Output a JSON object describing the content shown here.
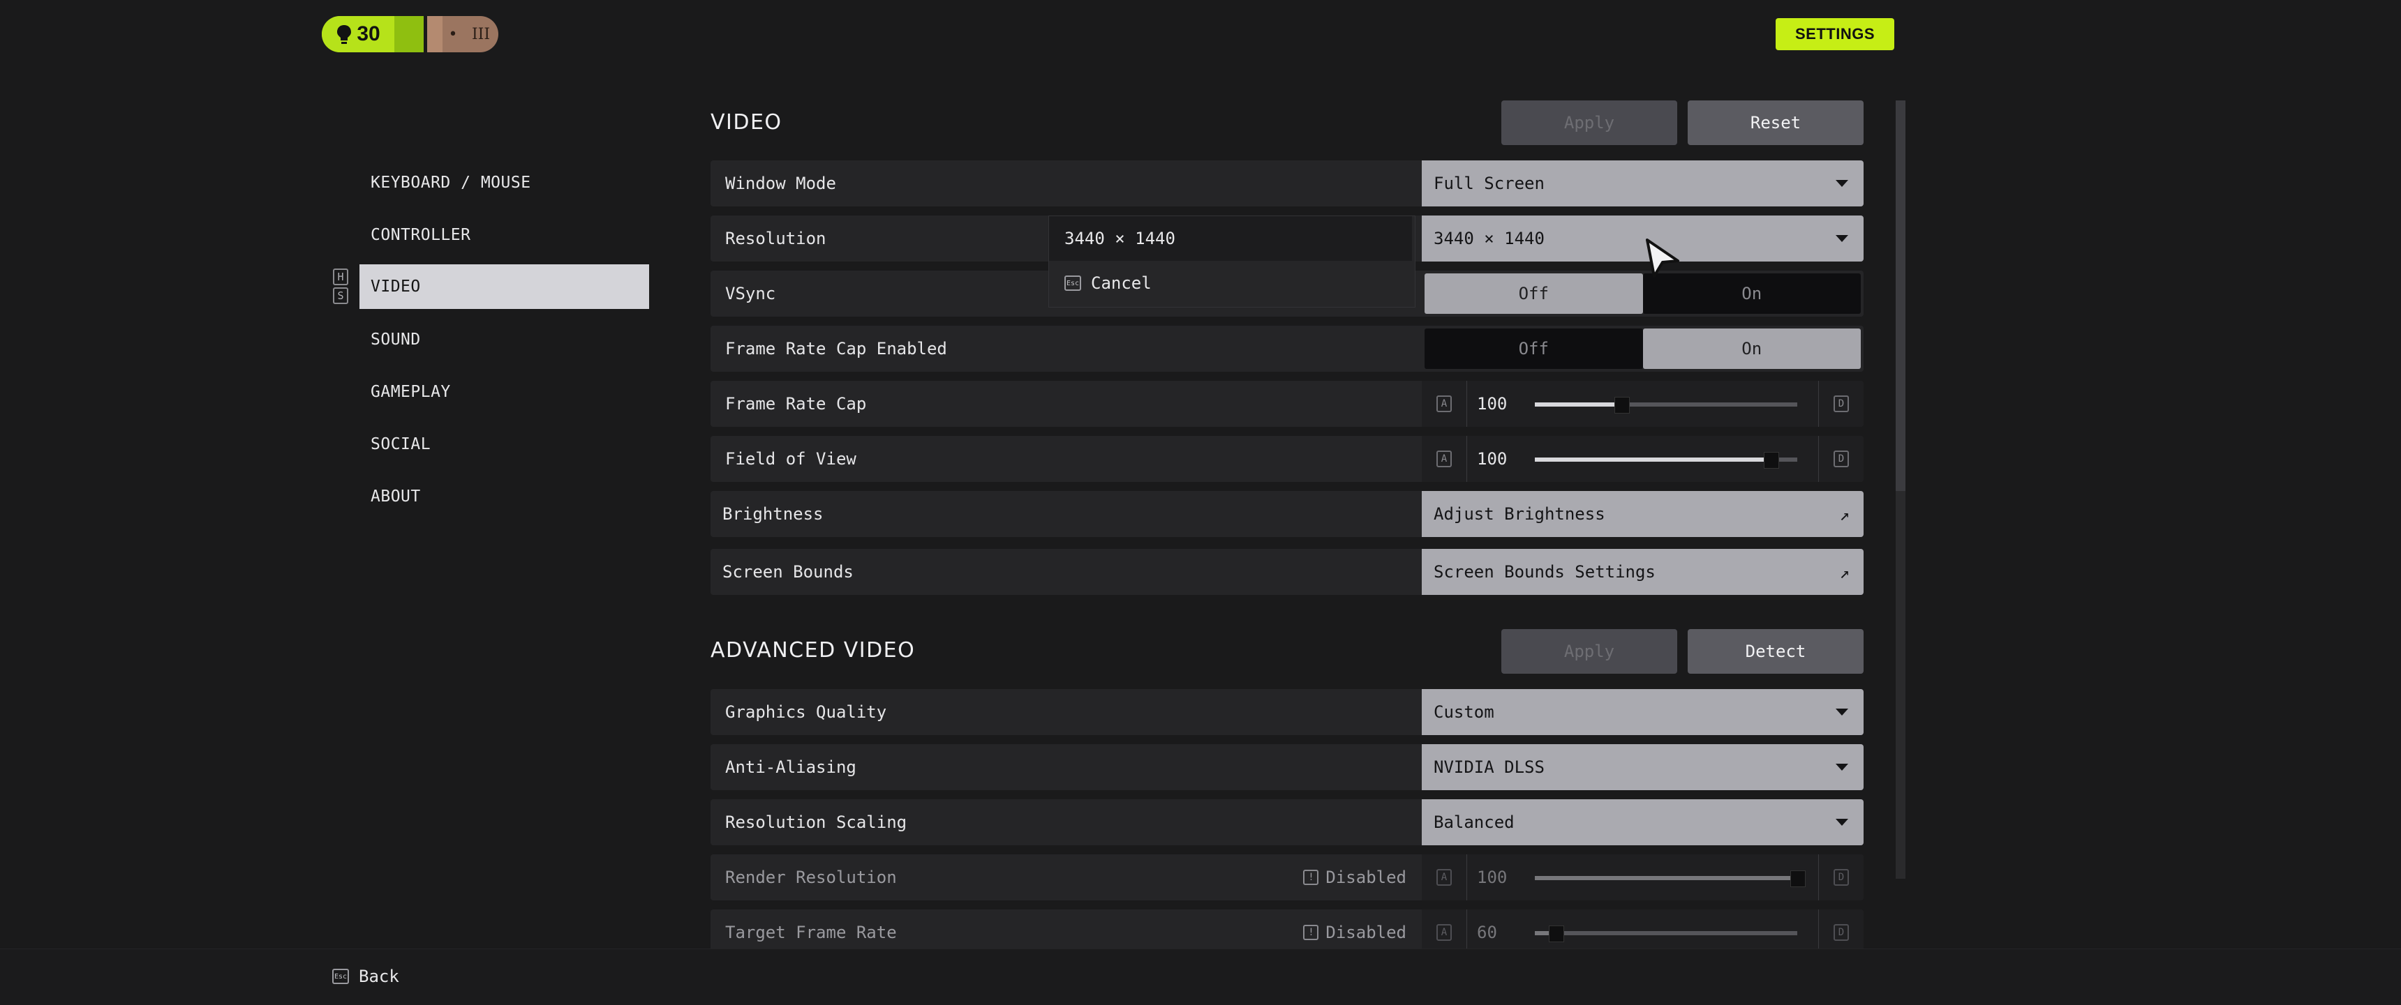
{
  "header": {
    "level": "30",
    "rank_marks": [
      "•",
      "III"
    ],
    "settings_label": "SETTINGS"
  },
  "sidebar": {
    "items": [
      {
        "label": "KEYBOARD / MOUSE"
      },
      {
        "label": "CONTROLLER"
      },
      {
        "label": "VIDEO"
      },
      {
        "label": "SOUND"
      },
      {
        "label": "GAMEPLAY"
      },
      {
        "label": "SOCIAL"
      },
      {
        "label": "ABOUT"
      }
    ],
    "hotkeys": [
      "H",
      "S"
    ]
  },
  "video": {
    "title": "VIDEO",
    "apply_label": "Apply",
    "reset_label": "Reset",
    "window_mode": {
      "label": "Window Mode",
      "value": "Full Screen"
    },
    "resolution": {
      "label": "Resolution",
      "value": "3440 × 1440"
    },
    "vsync": {
      "label": "VSync",
      "off": "Off",
      "on": "On",
      "selected": "Off"
    },
    "frame_cap_enabled": {
      "label": "Frame Rate Cap Enabled",
      "off": "Off",
      "on": "On",
      "selected": "On"
    },
    "frame_cap": {
      "label": "Frame Rate Cap",
      "value": "100",
      "key_left": "A",
      "key_right": "D",
      "level": 0.33
    },
    "fov": {
      "label": "Field of View",
      "value": "100",
      "key_left": "A",
      "key_right": "D",
      "level": 0.9
    },
    "brightness": {
      "label": "Brightness",
      "button": "Adjust Brightness"
    },
    "screen_bounds": {
      "label": "Screen Bounds",
      "button": "Screen Bounds Settings"
    }
  },
  "resolution_popup": {
    "option": "3440 × 1440",
    "cancel": "Cancel",
    "esc_key": "Esc"
  },
  "advanced": {
    "title": "ADVANCED VIDEO",
    "apply_label": "Apply",
    "detect_label": "Detect",
    "graphics_quality": {
      "label": "Graphics Quality",
      "value": "Custom"
    },
    "anti_aliasing": {
      "label": "Anti-Aliasing",
      "value": "NVIDIA DLSS"
    },
    "resolution_scaling": {
      "label": "Resolution Scaling",
      "value": "Balanced"
    },
    "render_resolution": {
      "label": "Render Resolution",
      "status": "Disabled",
      "value": "100",
      "key_left": "A",
      "key_right": "D",
      "level": 1.0
    },
    "target_frame_rate": {
      "label": "Target Frame Rate",
      "status": "Disabled",
      "value": "60",
      "key_left": "A",
      "key_right": "D",
      "level": 0.08
    }
  },
  "footer": {
    "back_label": "Back",
    "esc_key": "Esc"
  },
  "icons": {
    "level_badge": "lightbulb-icon",
    "arrow": "external-arrow-icon",
    "caret": "chevron-down-icon",
    "info": "info-icon"
  }
}
